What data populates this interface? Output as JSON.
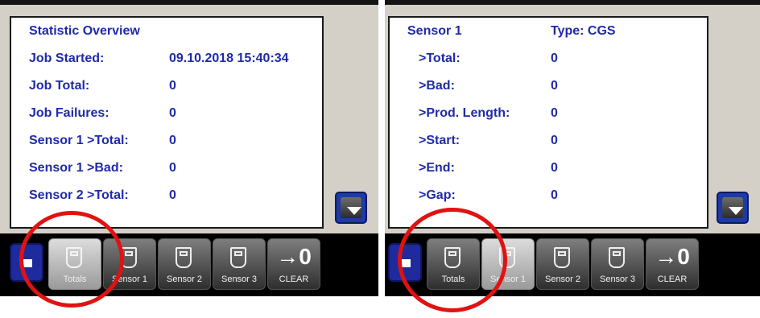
{
  "left_screen": {
    "rows": [
      {
        "label": "Statistic Overview",
        "value": ""
      },
      {
        "label": "Job Started:",
        "value": "09.10.2018 15:40:34"
      },
      {
        "label": "Job Total:",
        "value": "0"
      },
      {
        "label": "Job Failures:",
        "value": "0"
      },
      {
        "label": "Sensor 1 >Total:",
        "value": "0"
      },
      {
        "label": "Sensor 1 >Bad:",
        "value": "0"
      },
      {
        "label": "Sensor 2 >Total:",
        "value": "0"
      }
    ],
    "tabs": {
      "totals": "Totals",
      "sensor1": "Sensor 1",
      "sensor2": "Sensor 2",
      "sensor3": "Sensor 3",
      "clear_symbol": "→0",
      "clear": "CLEAR"
    }
  },
  "right_screen": {
    "header": {
      "label": "Sensor 1",
      "value": "Type: CGS"
    },
    "rows": [
      {
        "label": ">Total:",
        "value": "0"
      },
      {
        "label": ">Bad:",
        "value": "0"
      },
      {
        "label": ">Prod. Length:",
        "value": "0"
      },
      {
        "label": ">Start:",
        "value": "0"
      },
      {
        "label": ">End:",
        "value": "0"
      },
      {
        "label": ">Gap:",
        "value": "0"
      }
    ],
    "tabs": {
      "totals": "Totals",
      "sensor1": "Sensor 1",
      "sensor2": "Sensor 2",
      "sensor3": "Sensor 3",
      "clear_symbol": "→0",
      "clear": "CLEAR"
    }
  },
  "icons": {
    "scroll": "scroll-down-icon",
    "back": "back-arrow-icon",
    "sensor": "sensor-icon"
  },
  "colors": {
    "text": "#1f2aa8",
    "highlight_ring": "#e01212",
    "button_blue": "#1e3aa8"
  }
}
